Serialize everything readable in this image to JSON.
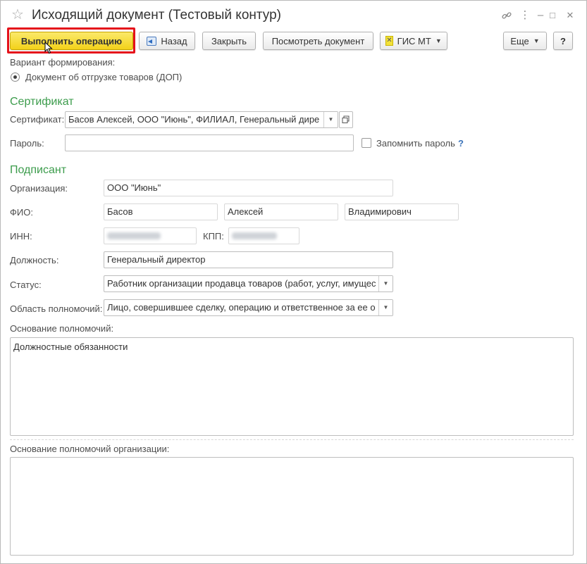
{
  "window": {
    "title": "Исходящий документ (Тестовый контур)",
    "icons": {
      "favorite": "☆",
      "link": "🔗",
      "menu": "⋮",
      "minimize": "–",
      "maximize": "□",
      "close": "✕"
    }
  },
  "toolbar": {
    "execute_label": "Выполнить операцию",
    "back_label": "Назад",
    "close_label": "Закрыть",
    "view_doc_label": "Посмотреть документ",
    "gis_label": "ГИС МТ",
    "more_label": "Еще",
    "help_label": "?"
  },
  "variant": {
    "label": "Вариант формирования:",
    "option": "Документ об отгрузке товаров (ДОП)"
  },
  "certificate_section": {
    "heading": "Сертификат",
    "cert_label": "Сертификат:",
    "cert_value": "Басов Алексей, ООО \"Июнь\", ФИЛИАЛ, Генеральный дире",
    "password_label": "Пароль:",
    "password_value": "",
    "remember_label": "Запомнить пароль",
    "remember_help": "?"
  },
  "signer": {
    "heading": "Подписант",
    "org_label": "Организация:",
    "org_value": "ООО \"Июнь\"",
    "fio_label": "ФИО:",
    "last_name": "Басов",
    "first_name": "Алексей",
    "middle_name": "Владимирович",
    "inn_label": "ИНН:",
    "kpp_label": "КПП:",
    "position_label": "Должность:",
    "position_value": "Генеральный директор",
    "status_label": "Статус:",
    "status_value": "Работник организации продавца товаров (работ, услуг, имущес",
    "authority_area_label": "Область полномочий:",
    "authority_area_value": "Лицо, совершившее сделку, операцию и ответственное за ее о",
    "authority_basis_label": "Основание полномочий:",
    "authority_basis_value": "Должностные обязанности",
    "org_authority_basis_label": "Основание полномочий организации:",
    "org_authority_basis_value": ""
  },
  "colors": {
    "accent_green": "#3c9c4c",
    "primary_yellow": "#f3d21a",
    "highlight_red": "#e5121b"
  }
}
